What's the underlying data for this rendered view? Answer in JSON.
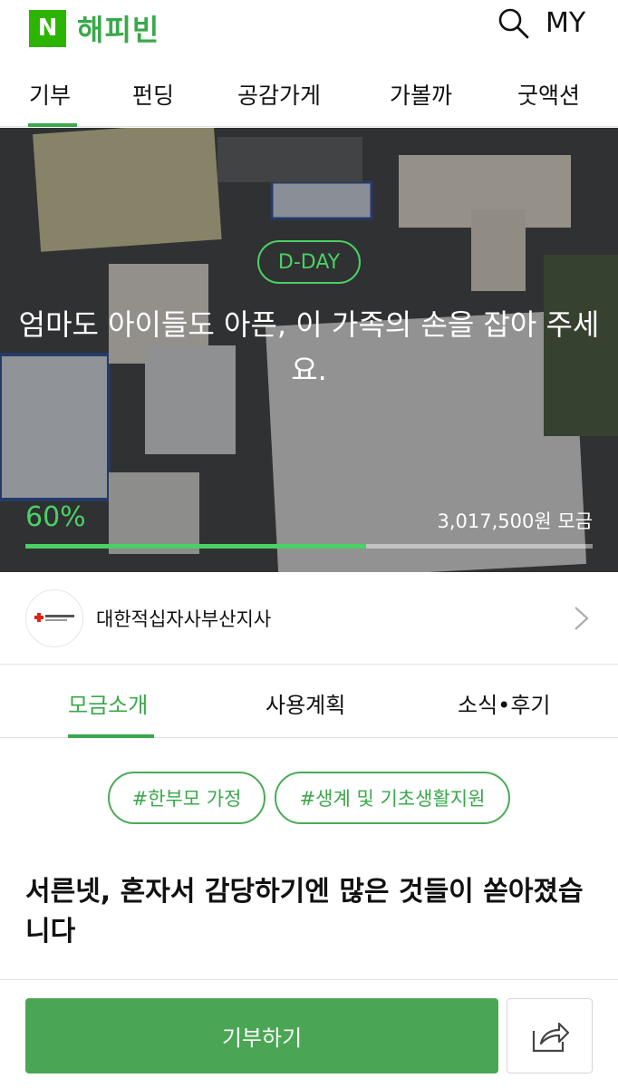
{
  "header": {
    "logo_badge": "N",
    "logo_text": "해피빈",
    "search_icon": "search-icon",
    "my_label": "MY"
  },
  "category_nav": {
    "items": [
      {
        "label": "기부",
        "active": true
      },
      {
        "label": "펀딩",
        "active": false
      },
      {
        "label": "공감가게",
        "active": false
      },
      {
        "label": "가볼까",
        "active": false
      },
      {
        "label": "굿액션",
        "active": false
      }
    ]
  },
  "hero": {
    "badge": "D-DAY",
    "title": "엄마도 아이들도 아픈, 이 가족의 손을 잡아 주세요.",
    "percent_label": "60%",
    "progress": 0.6,
    "amount": "3,017,500원 모금"
  },
  "organization": {
    "name": "대한적십자사부산지사",
    "avatar_icon": "red-cross-logo-icon"
  },
  "detail_tabs": [
    {
      "label": "모금소개",
      "active": true
    },
    {
      "label": "사용계획",
      "active": false
    },
    {
      "label": "소식•후기",
      "active": false
    }
  ],
  "tags": [
    "#한부모 가정",
    "#생계 및 기초생활지원"
  ],
  "headline": "서른넷, 혼자서 감당하기엔 많은 것들이 쏟아졌습니다",
  "bottom": {
    "donate_label": "기부하기",
    "share_icon": "share-icon"
  },
  "colors": {
    "brand_green": "#3aa84b",
    "logo_green": "#2db400",
    "button_green": "#4aa654"
  }
}
